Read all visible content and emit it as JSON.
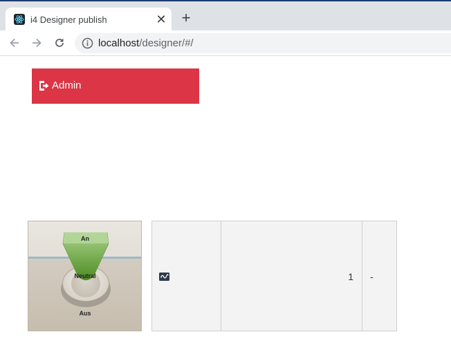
{
  "browser": {
    "tab_title": "i4 Designer publish",
    "tab_close": "✕",
    "new_tab": "+",
    "url_host": "localhost",
    "url_path": "/designer/#/"
  },
  "page": {
    "admin_button": {
      "label": "Admin",
      "color": "#dc3545"
    },
    "switch": {
      "label_on": "An",
      "label_neutral": "Neutral",
      "label_off": "Aus",
      "active_color": "#5c9a2c"
    },
    "data_row": {
      "icon": "signal-wave-icon",
      "value": "1",
      "unit": "-"
    }
  }
}
